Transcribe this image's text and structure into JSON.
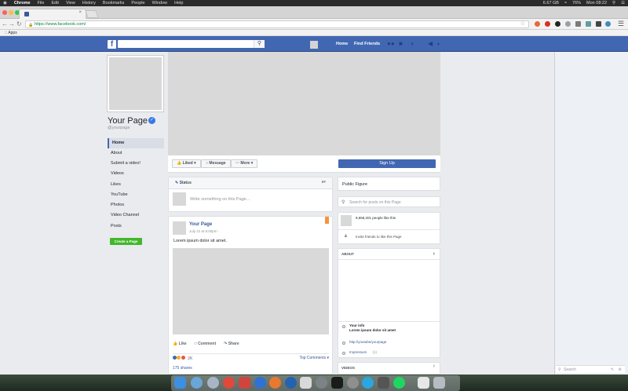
{
  "menubar": {
    "app": "Chrome",
    "items": [
      "File",
      "Edit",
      "View",
      "History",
      "Bookmarks",
      "People",
      "Window",
      "Help"
    ],
    "status": [
      "6.67 GB",
      "76%",
      "Mon 08:22"
    ]
  },
  "browser": {
    "url": "https://www.facebook.com/",
    "bookmarks_label": "Apps"
  },
  "fb_nav": {
    "home": "Home",
    "find_friends": "Find Friends"
  },
  "page": {
    "title": "Your Page",
    "handle": "@yourpage",
    "nav": [
      "Home",
      "About",
      "Submit a video!",
      "Videos",
      "Likes",
      "YouTube",
      "Photos",
      "Video Channel",
      "Posts"
    ],
    "create_button": "Create a Page"
  },
  "actions": {
    "liked": "Liked ▾",
    "message": "Message",
    "more": "More ▾",
    "signup": "Sign Up"
  },
  "composer": {
    "status_tab": "Status",
    "placeholder": "Write something on this Page..."
  },
  "post": {
    "author": "Your Page",
    "date": "July 22 at 8:00pm ·",
    "text": "Lorem ipsum dolor sit amet.",
    "like": "Like",
    "comment": "Comment",
    "share": "Share",
    "reactions": "2K",
    "top_comments": "Top Comments ▾",
    "shares": "175 shares"
  },
  "right_column": {
    "category": "Public Figure",
    "search_placeholder": "Search for posts on this Page",
    "likes_count": "9,658,201 people like this",
    "invite": "Invite friends to like this Page",
    "about_header": "ABOUT",
    "info_title": "Your info",
    "info_body": "Lorem ipsum dolor sit amet",
    "link": "http://youtube/yourpage",
    "impressum": "Impressum",
    "impressum_count": "(1)",
    "videos_header": "VIDEOS"
  },
  "chat": {
    "search_placeholder": "Search"
  },
  "colors": {
    "fb_blue": "#4267b2",
    "link_blue": "#365899",
    "green": "#42b72a"
  }
}
